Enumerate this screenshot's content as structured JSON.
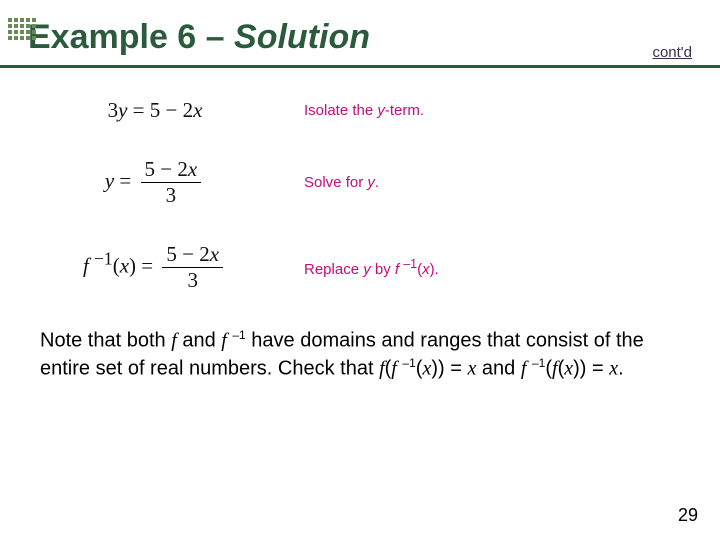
{
  "header": {
    "title_prefix": "Example 6 – ",
    "title_italic": "Solution",
    "contd": "cont'd"
  },
  "steps": [
    {
      "math_html": "3<i>y</i> = 5 − 2<i>x</i>",
      "annot": "Isolate the <i>y</i>-term."
    },
    {
      "math_html": "<i>y</i> = <span class=\"frac\"><span class=\"num\">5 − 2<i>x</i></span><span class=\"den\">3</span></span>",
      "annot": "Solve for <i>y</i>."
    },
    {
      "math_html": "<i>f</i>&nbsp;<sup>−1</sup>(<i>x</i>) = <span class=\"frac\"><span class=\"num\">5 − 2<i>x</i></span><span class=\"den\">3</span></span>",
      "annot": "Replace <i>y</i> by <i>f</i>&nbsp;<sup>–1</sup>(<i>x</i>)."
    }
  ],
  "note": "Note that both <i>f</i> and <i>f</i>&nbsp;<span class=\"sup\">–1</span> have domains and ranges that consist of the entire set of real numbers. Check that <i>f</i>(<i>f</i>&nbsp;<span class=\"sup\">–1</span>(<i>x</i>)) = <i>x</i> and <i>f</i>&nbsp;<span class=\"sup\">–1</span>(<i>f</i>(<i>x</i>)) = <i>x</i>.",
  "page_number": "29"
}
